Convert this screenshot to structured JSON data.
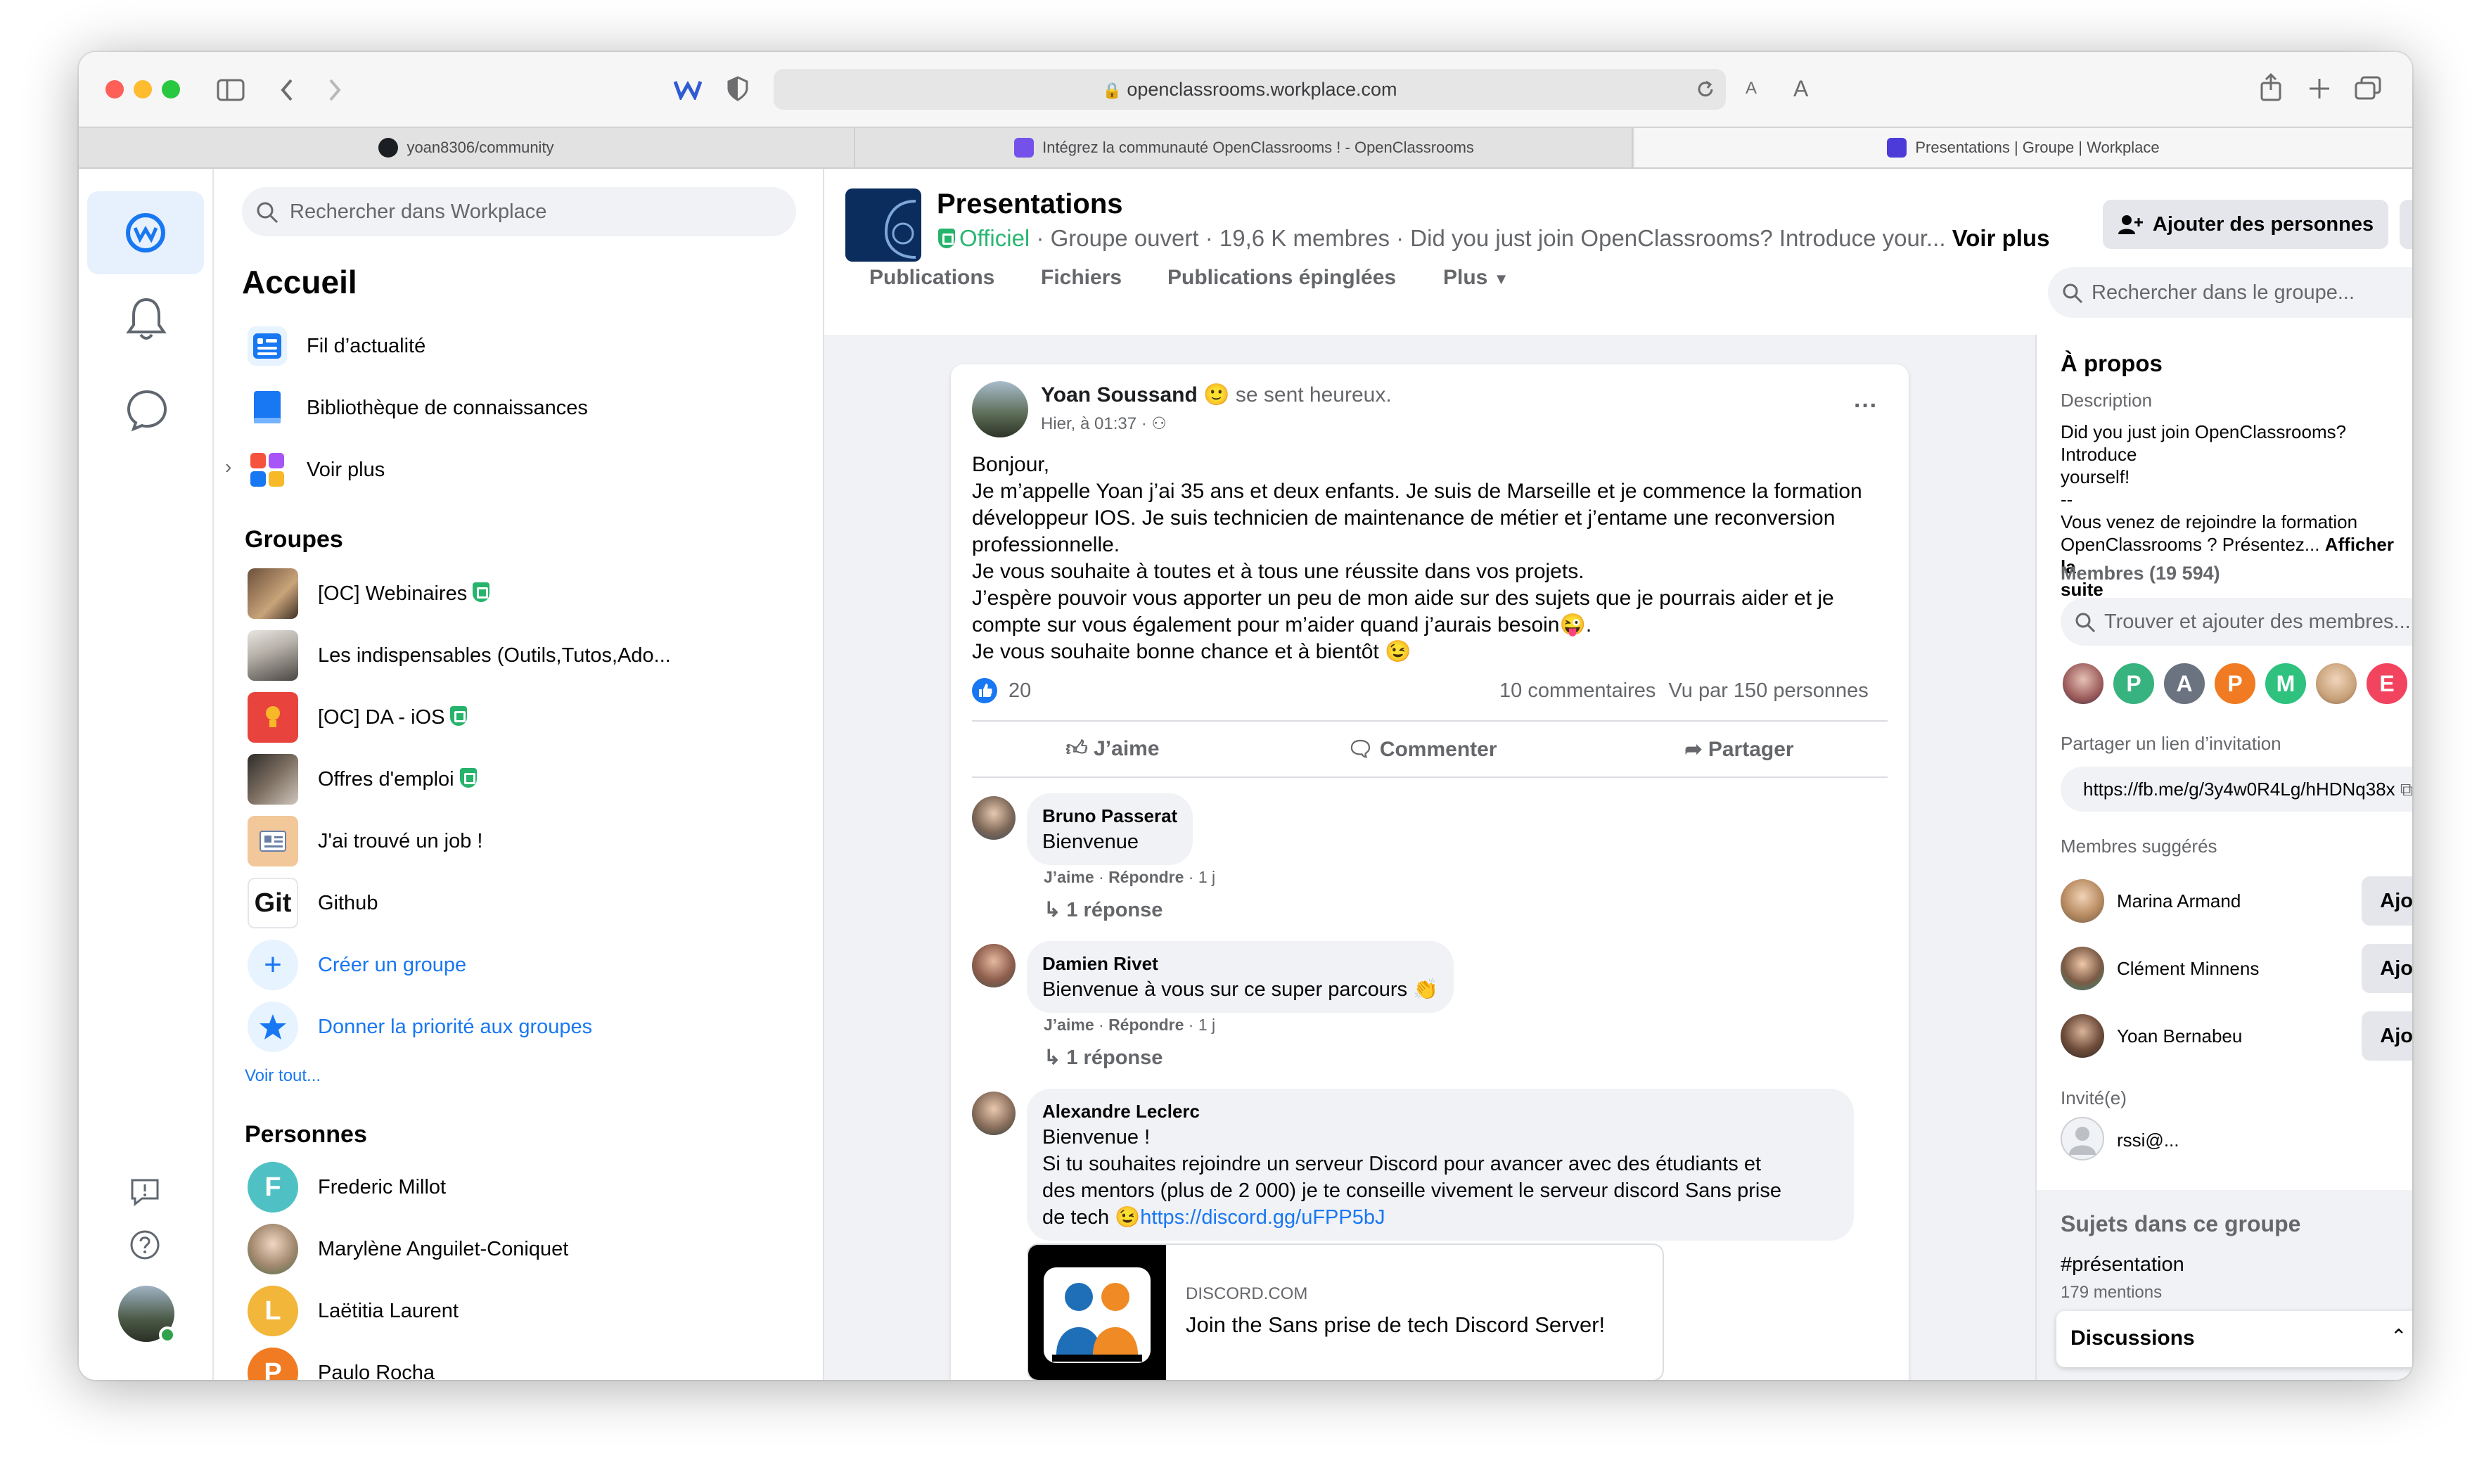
{
  "browser": {
    "url": "openclassrooms.workplace.com",
    "reader_small": "A",
    "reader_large": "A",
    "tabs": [
      {
        "label": "yoan8306/community"
      },
      {
        "label": "Intégrez la communauté OpenClassrooms ! - OpenClassrooms"
      },
      {
        "label": "Presentations | Groupe | Workplace"
      }
    ]
  },
  "sidebar": {
    "search_placeholder": "Rechercher dans Workplace",
    "home_title": "Accueil",
    "home_items": [
      {
        "label": "Fil d’actualité"
      },
      {
        "label": "Bibliothèque de connaissances"
      },
      {
        "label": "Voir plus"
      }
    ],
    "groups_title": "Groupes",
    "groups": [
      {
        "label": "[OC] Webinaires"
      },
      {
        "label": "Les indispensables (Outils,Tutos,Ado..."
      },
      {
        "label": "[OC] DA - iOS"
      },
      {
        "label": "Offres d'emploi"
      },
      {
        "label": "J'ai trouvé un job !"
      },
      {
        "label": "Github",
        "icon_text": "Git"
      }
    ],
    "create_group": "Créer un groupe",
    "prioritize_groups": "Donner la priorité aux groupes",
    "see_all": "Voir tout...",
    "people_title": "Personnes",
    "people": [
      {
        "label": "Frederic Millot",
        "initial": "F",
        "color": "#4fc1c4"
      },
      {
        "label": "Marylène Anguilet-Coniquet"
      },
      {
        "label": "Laëtitia Laurent",
        "initial": "L",
        "color": "#f2b63a"
      },
      {
        "label": "Paulo Rocha",
        "initial": "P",
        "color": "#f07b22"
      }
    ]
  },
  "group": {
    "name": "Presentations",
    "official": "Officiel",
    "meta": "· Groupe ouvert · 19,6 K membres · Did you just join OpenClassrooms? Introduce your...",
    "see_more": "Voir plus",
    "add_people": "Ajouter des personnes",
    "more": "···",
    "tabs": [
      {
        "label": "Publications"
      },
      {
        "label": "Fichiers"
      },
      {
        "label": "Publications épinglées"
      },
      {
        "label": "Plus"
      }
    ],
    "search_placeholder": "Rechercher dans le groupe..."
  },
  "post": {
    "author": "Yoan Soussand",
    "feeling": "se sent heureux.",
    "time": "Hier, à 01:37 ·",
    "lines": [
      "Bonjour,",
      "Je m’appelle Yoan j’ai 35 ans et deux enfants. Je suis de Marseille et je commence la formation",
      "développeur IOS. Je suis technicien de maintenance de métier et j’entame une reconversion",
      "professionnelle.",
      "Je vous souhaite à toutes et à tous une réussite dans vos projets.",
      "J’espère pouvoir vous apporter un peu de mon aide sur des sujets que je pourrais aider et je",
      "compte sur vous également pour m’aider quand j’aurais besoin😜.",
      "Je vous souhaite bonne chance et à bientôt 😉"
    ],
    "likes": "20",
    "comments_count": "10 commentaires",
    "seen_by": "Vu par 150 personnes",
    "like_label": "J’aime",
    "comment_label": "Commenter",
    "share_label": "Partager"
  },
  "comments": [
    {
      "name": "Bruno Passerat",
      "text": "Bienvenue",
      "like": "J’aime",
      "reply": "Répondre",
      "age": "1 j",
      "replies": "1 réponse"
    },
    {
      "name": "Damien Rivet",
      "text": "Bienvenue à vous sur ce super parcours 👏",
      "like": "J’aime",
      "reply": "Répondre",
      "age": "1 j",
      "replies": "1 réponse"
    },
    {
      "name": "Alexandre Leclerc",
      "line1": "Bienvenue !",
      "line2": "Si tu souhaites rejoindre un serveur Discord pour avancer avec des étudiants et",
      "line3": "des mentors (plus de 2 000) je te conseille vivement le serveur discord Sans prise",
      "line4": "de tech 😉",
      "link": "https://discord.gg/uFPP5bJ",
      "preview_domain": "DISCORD.COM",
      "preview_title": "Join the Sans prise de tech Discord Server!"
    }
  ],
  "about": {
    "title": "À propos",
    "description_label": "Description",
    "desc1": "Did you just join OpenClassrooms? Introduce",
    "desc2": "yourself!",
    "desc3": "--",
    "desc4": "Vous venez de rejoindre la formation",
    "desc5": "OpenClassrooms ? Présentez...",
    "show_more1": "Afficher la",
    "show_more2": "suite",
    "members_label": "Membres (19 594)",
    "find_members_placeholder": "Trouver et ajouter des membres...",
    "member_avatars": [
      {
        "initial": "",
        "color": "#8a5a4a"
      },
      {
        "initial": "P",
        "color": "#36b37e"
      },
      {
        "initial": "A",
        "color": "#6b7280"
      },
      {
        "initial": "P",
        "color": "#f07b22"
      },
      {
        "initial": "M",
        "color": "#2ec27e"
      },
      {
        "initial": "",
        "color": "#c9a27a"
      },
      {
        "initial": "E",
        "color": "#f2435f"
      },
      {
        "initial": "",
        "color": "#4a5a4f"
      }
    ],
    "invite_label": "Partager un lien d’invitation",
    "invite_link": "https://fb.me/g/3y4w0R4Lg/hHDNq38x",
    "suggested_label": "Membres suggérés",
    "suggested": [
      {
        "name": "Marina Armand",
        "button": "Ajouter"
      },
      {
        "name": "Clément Minnens",
        "button": "Ajouter"
      },
      {
        "name": "Yoan Bernabeu",
        "button": "Ajouter"
      }
    ],
    "invited_label": "Invité(e)",
    "invited_user": "rssi@...",
    "topics_title": "Sujets dans ce groupe",
    "topic": "#présentation",
    "topic_count": "179 mentions",
    "discussions": "Discussions"
  },
  "colors": {
    "accent": "#1877f2",
    "official": "#2bb673",
    "background": "#f0f2f5"
  }
}
